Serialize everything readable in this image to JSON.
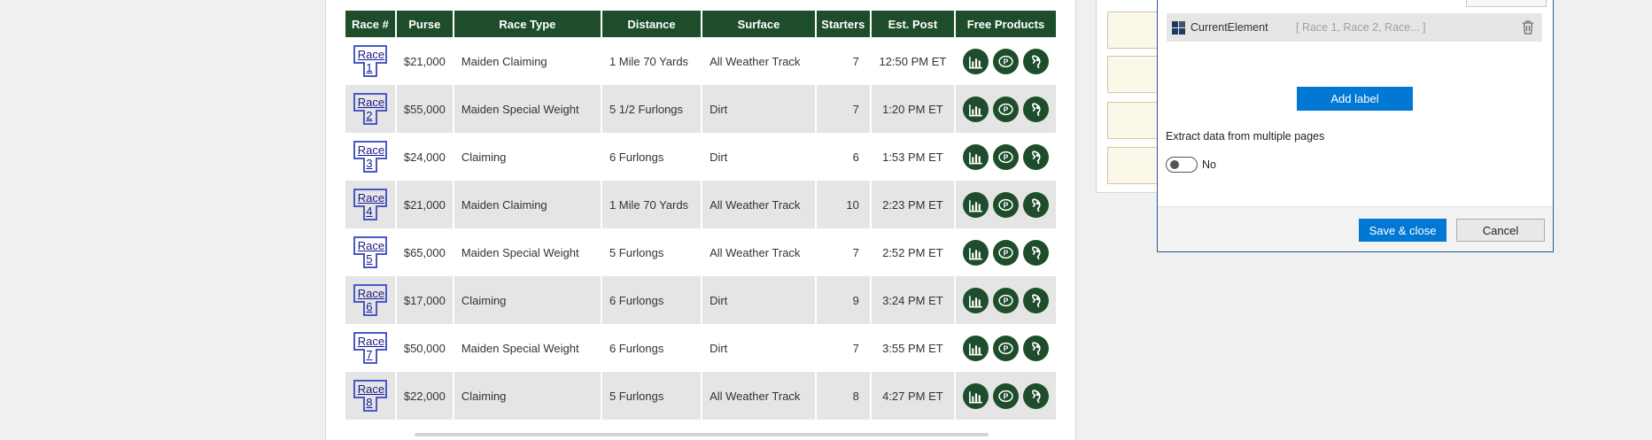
{
  "table": {
    "headers": [
      "Race #",
      "Purse",
      "Race Type",
      "Distance",
      "Surface",
      "Starters",
      "Est. Post",
      "Free Products"
    ],
    "rows": [
      {
        "race": "Race 1",
        "purse": "$21,000",
        "type": "Maiden Claiming",
        "distance": "1 Mile 70 Yards",
        "surface": "All Weather Track",
        "starters": "7",
        "post": "12:50 PM ET"
      },
      {
        "race": "Race 2",
        "purse": "$55,000",
        "type": "Maiden Special Weight",
        "distance": "5 1/2 Furlongs",
        "surface": "Dirt",
        "starters": "7",
        "post": "1:20 PM ET"
      },
      {
        "race": "Race 3",
        "purse": "$24,000",
        "type": "Claiming",
        "distance": "6 Furlongs",
        "surface": "Dirt",
        "starters": "6",
        "post": "1:53 PM ET"
      },
      {
        "race": "Race 4",
        "purse": "$21,000",
        "type": "Maiden Claiming",
        "distance": "1 Mile 70 Yards",
        "surface": "All Weather Track",
        "starters": "10",
        "post": "2:23 PM ET"
      },
      {
        "race": "Race 5",
        "purse": "$65,000",
        "type": "Maiden Special Weight",
        "distance": "5 Furlongs",
        "surface": "All Weather Track",
        "starters": "7",
        "post": "2:52 PM ET"
      },
      {
        "race": "Race 6",
        "purse": "$17,000",
        "type": "Claiming",
        "distance": "6 Furlongs",
        "surface": "Dirt",
        "starters": "9",
        "post": "3:24 PM ET"
      },
      {
        "race": "Race 7",
        "purse": "$50,000",
        "type": "Maiden Special Weight",
        "distance": "6 Furlongs",
        "surface": "Dirt",
        "starters": "7",
        "post": "3:55 PM ET"
      },
      {
        "race": "Race 8",
        "purse": "$22,000",
        "type": "Claiming",
        "distance": "5 Furlongs",
        "surface": "All Weather Track",
        "starters": "8",
        "post": "4:27 PM ET"
      }
    ],
    "product_icons": [
      "bar-chart-icon",
      "speed-p-icon",
      "horse-head-icon"
    ]
  },
  "dialog": {
    "element_name": "CurrentElement",
    "element_value": "[ Race 1, Race 2, Race... ]",
    "add_label": "Add label",
    "extract_label": "Extract data from multiple pages",
    "toggle_text": "No",
    "save_label": "Save & close",
    "cancel_label": "Cancel"
  },
  "colors": {
    "table_header": "#1e4d2b",
    "primary_button": "#0078d4",
    "row_alt": "#e5e5e5"
  }
}
